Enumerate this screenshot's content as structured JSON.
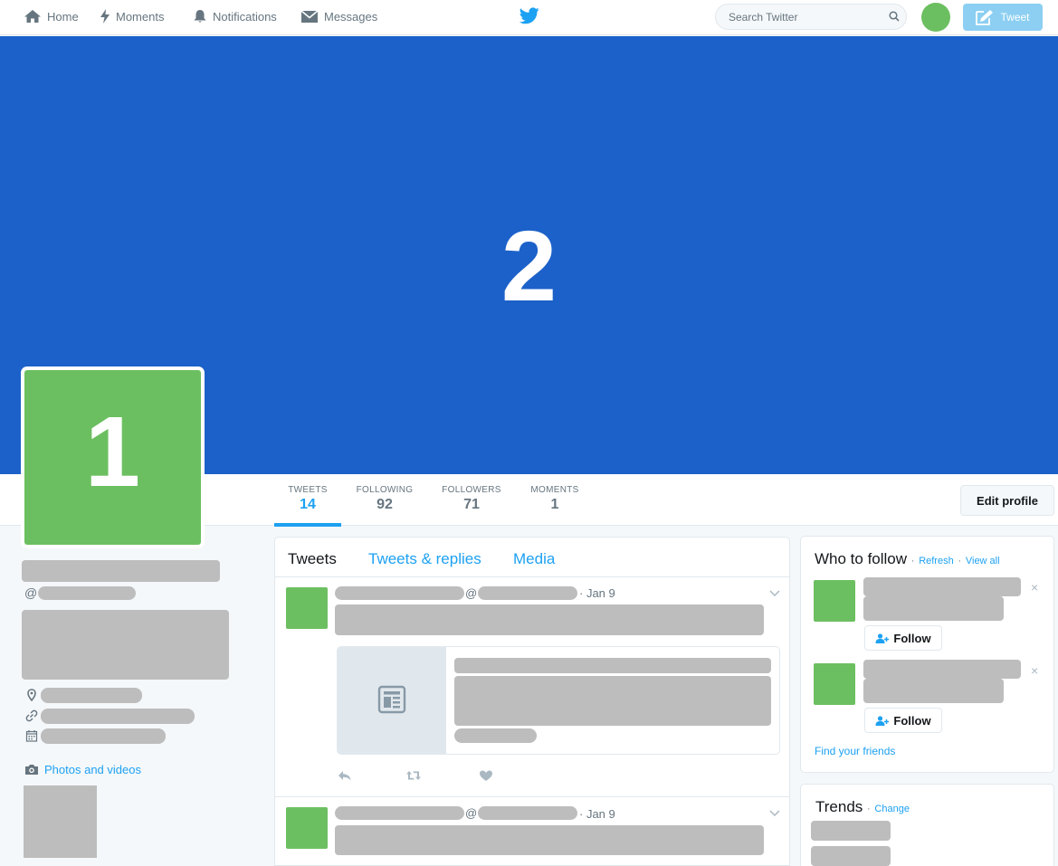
{
  "nav": {
    "home": "Home",
    "moments": "Moments",
    "notifications": "Notifications",
    "messages": "Messages",
    "logo_icon": "twitter-bird-icon",
    "search_placeholder": "Search Twitter",
    "tweet_button": "Tweet"
  },
  "banner": {
    "label": "2"
  },
  "profile": {
    "avatar_label": "1",
    "handle_prefix": "@"
  },
  "stats": [
    {
      "label": "TWEETS",
      "value": "14"
    },
    {
      "label": "FOLLOWING",
      "value": "92"
    },
    {
      "label": "FOLLOWERS",
      "value": "71"
    },
    {
      "label": "MOMENTS",
      "value": "1"
    }
  ],
  "edit_profile": "Edit profile",
  "sidebar": {
    "photos_and_videos": "Photos and videos"
  },
  "timeline": {
    "tabs": [
      "Tweets",
      "Tweets & replies",
      "Media"
    ],
    "tweets": [
      {
        "at": "@",
        "date": "· Jan 9"
      },
      {
        "at": "@",
        "date": "· Jan 9"
      }
    ]
  },
  "who_to_follow": {
    "title": "Who to follow",
    "refresh": "Refresh",
    "view_all": "View all",
    "separator": "·",
    "follow_label": "Follow",
    "dismiss": "×",
    "find_friends": "Find your friends"
  },
  "trends": {
    "title": "Trends",
    "change": "Change",
    "separator": "·"
  },
  "colors": {
    "accent": "#1da1f2",
    "banner": "#1c61c9",
    "avatar_placeholder": "#6cbf60",
    "redacted": "#bdbdbd"
  }
}
